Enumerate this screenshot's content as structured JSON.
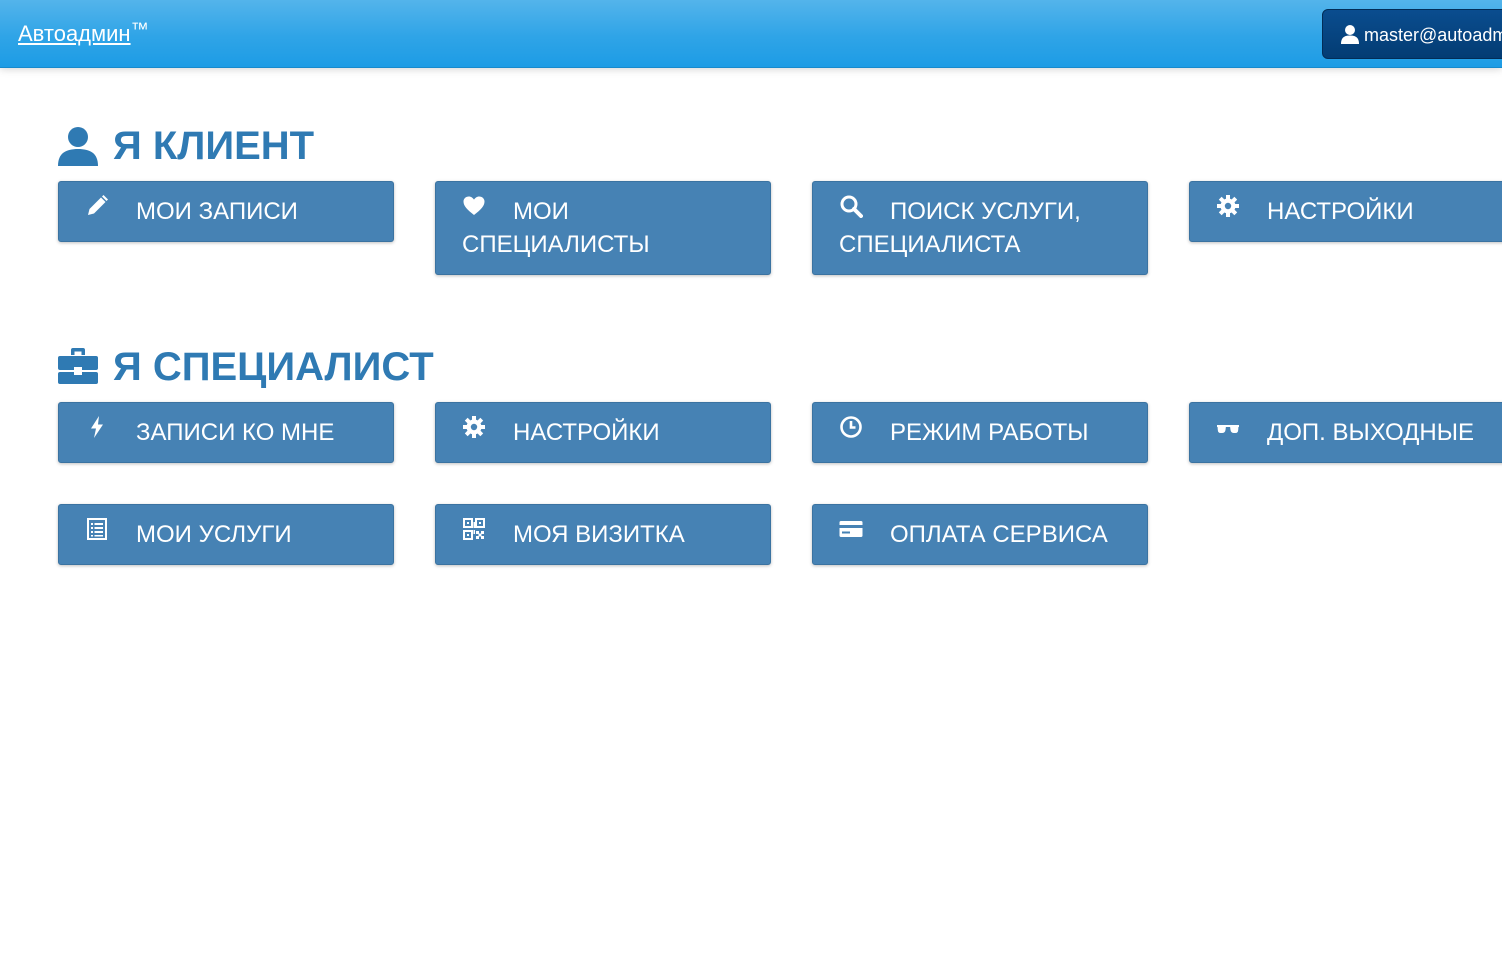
{
  "topbar": {
    "brand": "Автоадмин",
    "brand_mark": "™",
    "user_label": "master@autoadmin",
    "user_icon": "user-icon",
    "background_color": "#2fa4e7"
  },
  "client_section": {
    "icon": "user-icon",
    "title": "Я КЛИЕНТ",
    "color": "#2f7ab3",
    "tiles": [
      {
        "label": "МОИ ЗАПИСИ",
        "icon": "pencil-icon"
      },
      {
        "label": "МОИ СПЕЦИАЛИСТЫ",
        "icon": "heart-icon"
      },
      {
        "label": "ПОИСК УСЛУГИ, СПЕЦИАЛИСТА",
        "icon": "search-icon"
      },
      {
        "label": "НАСТРОЙКИ",
        "icon": "gear-icon"
      }
    ]
  },
  "specialist_section": {
    "icon": "briefcase-icon",
    "title": "Я СПЕЦИАЛИСТ",
    "tiles": [
      {
        "label": "ЗАПИСИ КО МНЕ",
        "icon": "flash-icon"
      },
      {
        "label": "НАСТРОЙКИ",
        "icon": "gear-icon"
      },
      {
        "label": "РЕЖИМ РАБОТЫ",
        "icon": "clock-icon"
      },
      {
        "label": "ДОП. ВЫХОДНЫЕ",
        "icon": "sunglasses-icon"
      },
      {
        "label": "МОИ УСЛУГИ",
        "icon": "list-icon"
      },
      {
        "label": "МОЯ ВИЗИТКА",
        "icon": "qrcode-icon"
      },
      {
        "label": "ОПЛАТА СЕРВИСА",
        "icon": "credit-card-icon"
      }
    ]
  },
  "tile_color": "#4682b4"
}
